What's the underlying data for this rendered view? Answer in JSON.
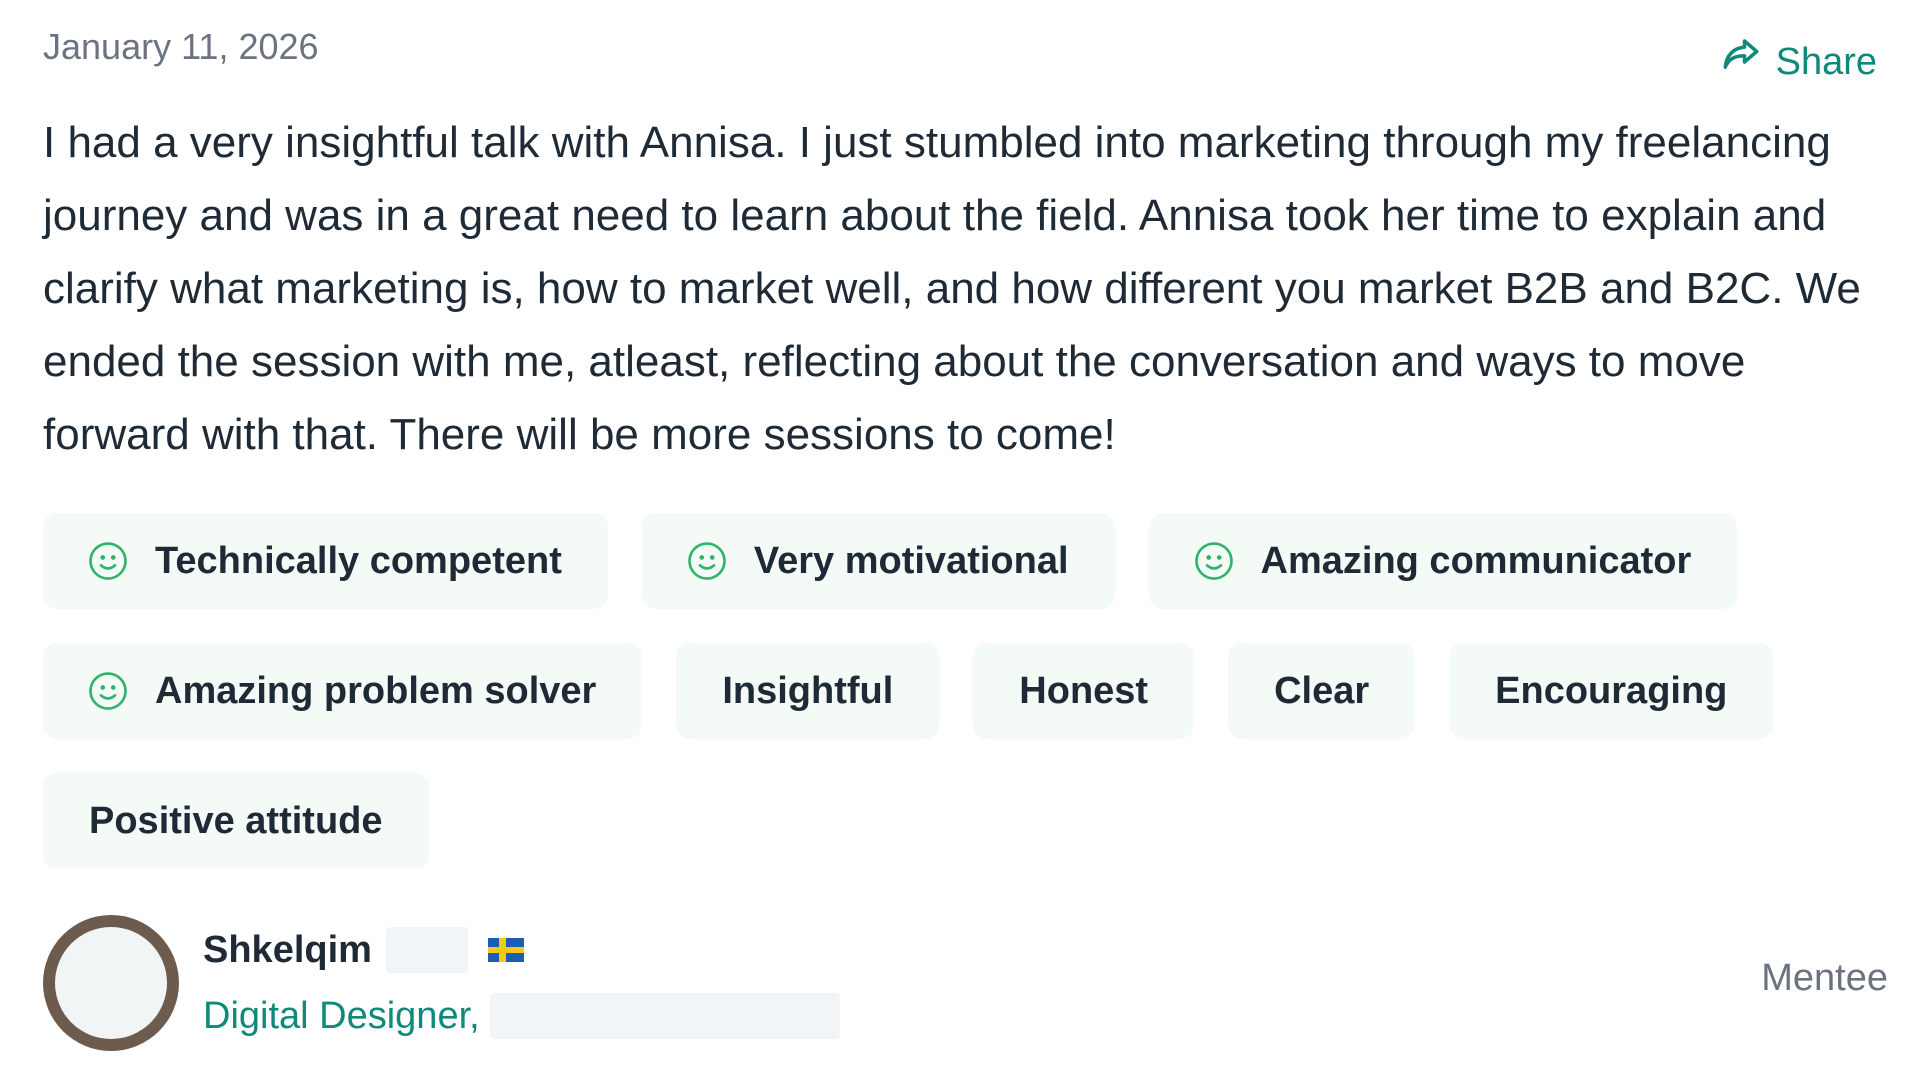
{
  "review": {
    "date": "January 11, 2026",
    "share_label": "Share",
    "text": "I had a very insightful talk with Annisa. I just stumbled into marketing through my freelancing journey and was in a great need to learn about the field. Annisa took her time to explain and clarify what marketing is, how to market well, and how different you market B2B and B2C. We ended the session with me, atleast, reflecting about the conversation and ways to move forward with that. There will be more sessions to come!"
  },
  "tags": [
    {
      "label": "Technically competent",
      "icon": "smile-icon"
    },
    {
      "label": "Very motivational",
      "icon": "smile-icon"
    },
    {
      "label": "Amazing communicator",
      "icon": "smile-icon"
    },
    {
      "label": "Amazing problem solver",
      "icon": "smile-icon"
    },
    {
      "label": "Insightful"
    },
    {
      "label": "Honest"
    },
    {
      "label": "Clear"
    },
    {
      "label": "Encouraging"
    },
    {
      "label": "Positive attitude"
    }
  ],
  "author": {
    "name": "Shkelqim",
    "flag": "sweden-flag-icon",
    "role": "Digital Designer,",
    "badge": "Mentee"
  },
  "colors": {
    "accent": "#0f8a7a",
    "tag_background": "#f4faf6",
    "text": "#1f2a37",
    "muted": "#6b7280"
  }
}
